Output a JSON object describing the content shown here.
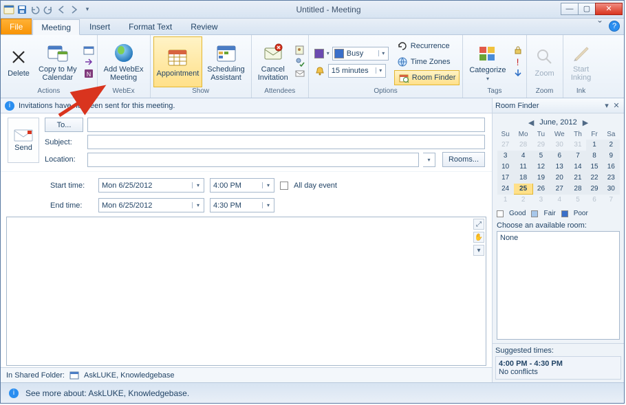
{
  "window_title": "Untitled  -  Meeting",
  "qat": {
    "save": "save-icon",
    "undo": "undo-icon",
    "redo": "redo-icon",
    "prev": "prev-icon",
    "next": "next-icon"
  },
  "tabs": {
    "file": "File",
    "meeting": "Meeting",
    "insert": "Insert",
    "format": "Format Text",
    "review": "Review"
  },
  "ribbon": {
    "actions": {
      "delete": "Delete",
      "copy": "Copy to My\nCalendar",
      "group": "Actions"
    },
    "webex": {
      "add": "Add WebEx\nMeeting",
      "group": "WebEx"
    },
    "show": {
      "appointment": "Appointment",
      "scheduling": "Scheduling\nAssistant",
      "group": "Show"
    },
    "attendees": {
      "cancel": "Cancel\nInvitation",
      "group": "Attendees"
    },
    "options": {
      "busy_value": "Busy",
      "reminder_value": "15 minutes",
      "recurrence": "Recurrence",
      "timezones": "Time Zones",
      "roomfinder": "Room Finder",
      "group": "Options"
    },
    "tags": {
      "categorize": "Categorize",
      "group": "Tags"
    },
    "zoom": {
      "zoom": "Zoom",
      "group": "Zoom"
    },
    "ink": {
      "start": "Start\nInking",
      "group": "Ink"
    }
  },
  "infobar": "Invitations have not been sent for this meeting.",
  "form": {
    "send": "Send",
    "to_btn": "To...",
    "to_value": "",
    "subject_lbl": "Subject:",
    "subject_value": "",
    "location_lbl": "Location:",
    "location_value": "",
    "rooms_btn": "Rooms...",
    "start_lbl": "Start time:",
    "start_date": "Mon 6/25/2012",
    "start_time": "4:00 PM",
    "end_lbl": "End time:",
    "end_date": "Mon 6/25/2012",
    "end_time": "4:30 PM",
    "allday": "All day event"
  },
  "shared": {
    "label": "In Shared Folder:",
    "name": "AskLUKE, Knowledgebase"
  },
  "status": "See more about: AskLUKE, Knowledgebase.",
  "roomfinder": {
    "title": "Room Finder",
    "month": "June, 2012",
    "dow": [
      "Su",
      "Mo",
      "Tu",
      "We",
      "Th",
      "Fr",
      "Sa"
    ],
    "weeks": [
      [
        27,
        28,
        29,
        30,
        31,
        1,
        2
      ],
      [
        3,
        4,
        5,
        6,
        7,
        8,
        9
      ],
      [
        10,
        11,
        12,
        13,
        14,
        15,
        16
      ],
      [
        17,
        18,
        19,
        20,
        21,
        22,
        23
      ],
      [
        24,
        25,
        26,
        27,
        28,
        29,
        30
      ],
      [
        1,
        2,
        3,
        4,
        5,
        6,
        7
      ]
    ],
    "legend": {
      "good": "Good",
      "fair": "Fair",
      "poor": "Poor"
    },
    "choose": "Choose an available room:",
    "choices": [
      "None"
    ],
    "suggested_label": "Suggested times:",
    "suggested_time": "4:00 PM - 4:30 PM",
    "suggested_sub": "No conflicts"
  }
}
